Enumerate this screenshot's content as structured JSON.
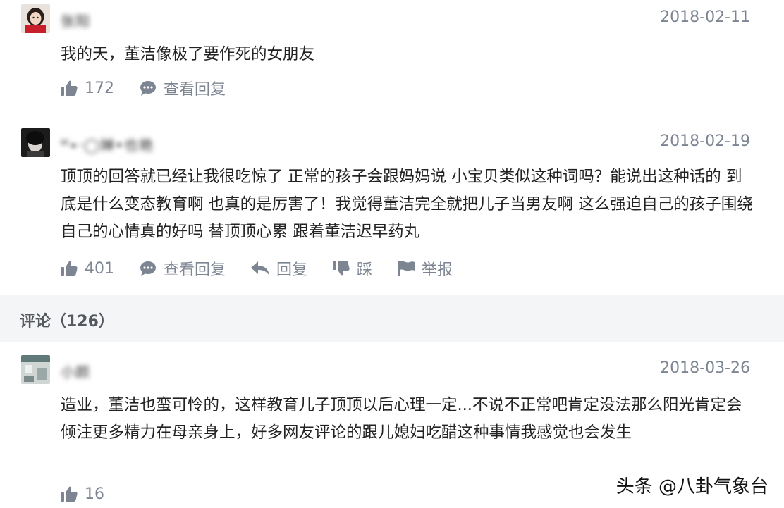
{
  "comments": [
    {
      "username": "张阳",
      "date": "2018-02-11",
      "text": "我的天，董洁像极了要作死的女朋友",
      "likes": "172",
      "view_replies": "查看回复"
    },
    {
      "username": "ᴹ∙·◯婵•也艳",
      "date": "2018-02-19",
      "text": "顶顶的回答就已经让我很吃惊了 正常的孩子会跟妈妈说 小宝贝类似这种词吗？能说出这种话的 到底是什么变态教育啊 也真的是厉害了！我觉得董洁完全就把儿子当男友啊 这么强迫自己的孩子围绕自己的心情真的好吗 替顶顶心累 跟着董洁迟早药丸",
      "likes": "401",
      "view_replies": "查看回复",
      "reply": "回复",
      "dislike": "踩",
      "report": "举报"
    }
  ],
  "section": {
    "title": "评论（126）"
  },
  "comments_section": [
    {
      "username": "小颜",
      "date": "2018-03-26",
      "text": "造业，董洁也蛮可怜的，这样教育儿子顶顶以后心理一定...不说不正常吧肯定没法那么阳光肯定会倾注更多精力在母亲身上，好多网友评论的跟儿媳妇吃醋这种事情我感觉也会发生",
      "likes": "16"
    }
  ],
  "watermark": "头条 @八卦气象台",
  "icons": {
    "like": "thumbs-up-icon",
    "comment": "speech-bubble-icon",
    "reply": "reply-arrow-icon",
    "dislike": "thumbs-down-icon",
    "report": "flag-icon"
  },
  "colors": {
    "meta_gray": "#7d8592",
    "section_bg": "#f4f5f6",
    "text": "#222222"
  }
}
